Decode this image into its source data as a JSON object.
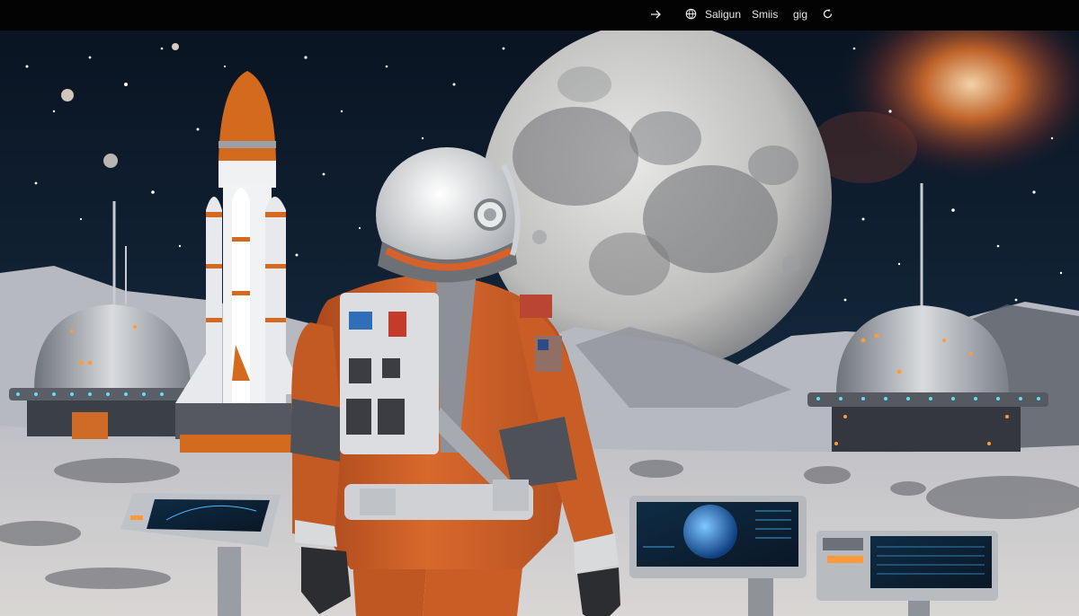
{
  "menubar": {
    "items": [
      {
        "icon": "arrow-icon",
        "label": ""
      },
      {
        "icon": "globe-icon",
        "label": "Saligun"
      },
      {
        "label": "Smiis"
      },
      {
        "label": "gig"
      },
      {
        "icon": "refresh-icon",
        "label": ""
      }
    ]
  },
  "colors": {
    "suit": "#d4622a",
    "sky": "#0d1a2a",
    "moon": "#cfcfcf",
    "ground": "#cfcfd2",
    "accent_light": "#5ee0ff",
    "rocket_tip": "#d46a1e"
  },
  "scene": {
    "subjects": [
      "astronaut",
      "rocket",
      "moon",
      "left-habitat-dome",
      "right-habitat-dome",
      "control-panels"
    ]
  }
}
